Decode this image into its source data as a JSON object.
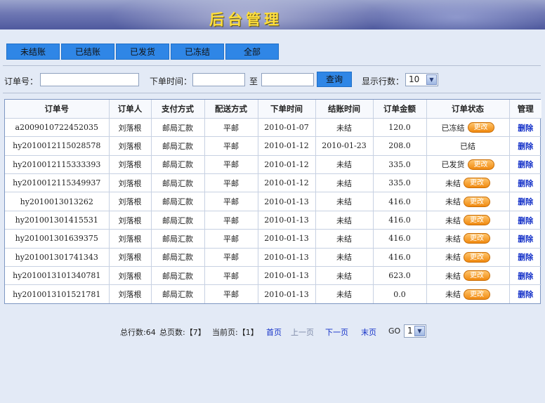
{
  "header": {
    "title": "后台管理"
  },
  "tabs": [
    "未结账",
    "已结账",
    "已发货",
    "已冻结",
    "全部"
  ],
  "search": {
    "order_no_label": "订单号：",
    "order_time_label": "下单时间：",
    "to_label": "至",
    "query_button": "查询",
    "rows_label": "显示行数：",
    "rows_value": "10",
    "order_no_value": "",
    "date_from_value": "",
    "date_to_value": ""
  },
  "table": {
    "columns": [
      "订单号",
      "订单人",
      "支付方式",
      "配送方式",
      "下单时间",
      "结账时间",
      "订单金额",
      "订单状态",
      "管理"
    ],
    "change_label": "更改",
    "delete_label": "删除",
    "rows": [
      {
        "no": "a2009010722452035",
        "person": "刘落根",
        "pay": "邮局汇款",
        "ship": "平邮",
        "order_time": "2010-01-07",
        "settle": "未结",
        "amount": "120.0",
        "status": "已冻结",
        "changeable": true
      },
      {
        "no": "hy2010012115028578",
        "person": "刘落根",
        "pay": "邮局汇款",
        "ship": "平邮",
        "order_time": "2010-01-12",
        "settle": "2010-01-23",
        "amount": "208.0",
        "status": "已结",
        "changeable": false
      },
      {
        "no": "hy2010012115333393",
        "person": "刘落根",
        "pay": "邮局汇款",
        "ship": "平邮",
        "order_time": "2010-01-12",
        "settle": "未结",
        "amount": "335.0",
        "status": "已发货",
        "changeable": true
      },
      {
        "no": "hy2010012115349937",
        "person": "刘落根",
        "pay": "邮局汇款",
        "ship": "平邮",
        "order_time": "2010-01-12",
        "settle": "未结",
        "amount": "335.0",
        "status": "未结",
        "changeable": true
      },
      {
        "no": "hy2010013013262",
        "person": "刘落根",
        "pay": "邮局汇款",
        "ship": "平邮",
        "order_time": "2010-01-13",
        "settle": "未结",
        "amount": "416.0",
        "status": "未结",
        "changeable": true
      },
      {
        "no": "hy201001301415531",
        "person": "刘落根",
        "pay": "邮局汇款",
        "ship": "平邮",
        "order_time": "2010-01-13",
        "settle": "未结",
        "amount": "416.0",
        "status": "未结",
        "changeable": true
      },
      {
        "no": "hy201001301639375",
        "person": "刘落根",
        "pay": "邮局汇款",
        "ship": "平邮",
        "order_time": "2010-01-13",
        "settle": "未结",
        "amount": "416.0",
        "status": "未结",
        "changeable": true
      },
      {
        "no": "hy201001301741343",
        "person": "刘落根",
        "pay": "邮局汇款",
        "ship": "平邮",
        "order_time": "2010-01-13",
        "settle": "未结",
        "amount": "416.0",
        "status": "未结",
        "changeable": true
      },
      {
        "no": "hy2010013101340781",
        "person": "刘落根",
        "pay": "邮局汇款",
        "ship": "平邮",
        "order_time": "2010-01-13",
        "settle": "未结",
        "amount": "623.0",
        "status": "未结",
        "changeable": true
      },
      {
        "no": "hy2010013101521781",
        "person": "刘落根",
        "pay": "邮局汇款",
        "ship": "平邮",
        "order_time": "2010-01-13",
        "settle": "未结",
        "amount": "0.0",
        "status": "未结",
        "changeable": true
      }
    ]
  },
  "pagination": {
    "total_rows": "总行数:64",
    "total_pages": "总页数:【7】",
    "current_page": "当前页:【1】",
    "first": "首页",
    "prev": "上一页",
    "next": "下一页",
    "last": "末页",
    "go_label": "GO",
    "go_value": "1"
  },
  "colors": {
    "accent_button": "#2f86e6",
    "change_button": "#f08a10",
    "link": "#1330c8",
    "title": "#ffdf3c"
  }
}
